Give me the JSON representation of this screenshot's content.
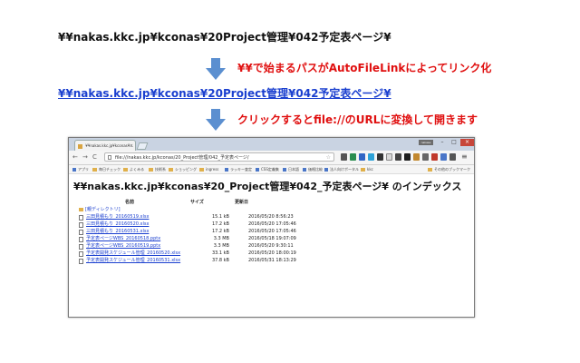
{
  "top_path": "¥¥nakas.kkc.jp¥kconas¥20Project管理¥042予定表ページ¥",
  "linked_path": "¥¥nakas.kkc.jp¥kconas¥20Project管理¥042予定表ページ¥",
  "note1": "¥¥で始まるパスがAutoFileLinkによってリンク化",
  "note2": "クリックするとfile://のURLに変換して開きます",
  "arrow_color": "#5b8fd0",
  "browser": {
    "tab_title": "¥¥nakas.kkc.jp¥kconas¥...",
    "tab_close": "×",
    "user_button": "nakase",
    "window_buttons": {
      "minimize": "–",
      "maximize": "□",
      "close": "×"
    },
    "nav": {
      "back": "←",
      "forward": "→",
      "reload": "C"
    },
    "address": "file:///nakas.kkc.jp/kconas/20_Project管理/042_予定表ページ/",
    "star": "☆",
    "menu": "≡",
    "bookmarks": [
      {
        "label": "アプリ",
        "icon": "grid-icon"
      },
      {
        "label": "毎日チェック",
        "icon": "folder-icon"
      },
      {
        "label": "よくみる",
        "icon": "folder-icon"
      },
      {
        "label": "技術系",
        "icon": "folder-icon"
      },
      {
        "label": "ショッピング",
        "icon": "folder-icon"
      },
      {
        "label": "ingress",
        "icon": "folder-icon"
      },
      {
        "label": "ラッキー査定",
        "icon": "page-icon"
      },
      {
        "label": "CSS定義集",
        "icon": "page-icon"
      },
      {
        "label": "日本語",
        "icon": "page-icon"
      },
      {
        "label": "価格比較",
        "icon": "page-icon"
      },
      {
        "label": "法人向けポータル",
        "icon": "page-icon"
      },
      {
        "label": "kkc",
        "icon": "folder-icon"
      }
    ],
    "other_bookmarks": "その他のブックマーク"
  },
  "listing": {
    "heading": "¥¥nakas.kkc.jp¥kconas¥20_Project管理¥042_予定表ページ¥ のインデックス",
    "columns": {
      "name": "名前",
      "size": "サイズ",
      "date": "更新日"
    },
    "parent_label": "[親ディレクトリ]",
    "files": [
      {
        "name": "三田見積もり_20160519.xlsx",
        "size": "15.1 kB",
        "date": "2016/05/20 8:56:23"
      },
      {
        "name": "三田見積もり_20160520.xlsx",
        "size": "17.2 kB",
        "date": "2016/05/20 17:05:46"
      },
      {
        "name": "三田見積もり_20160531.xlsx",
        "size": "17.2 kB",
        "date": "2016/05/20 17:05:46"
      },
      {
        "name": "予定表ページWBS_20160518.pptx",
        "size": "3.3 MB",
        "date": "2016/05/18 19:07:09"
      },
      {
        "name": "予定表ページWBS_20160519.pptx",
        "size": "3.3 MB",
        "date": "2016/05/20 9:30:11"
      },
      {
        "name": "予定表開発スケジュール管理_20160520.xlsx",
        "size": "33.1 kB",
        "date": "2016/05/20 18:00:19"
      },
      {
        "name": "予定表開発スケジュール管理_20160531.xlsx",
        "size": "37.8 kB",
        "date": "2016/05/31 18:13:29"
      }
    ]
  }
}
